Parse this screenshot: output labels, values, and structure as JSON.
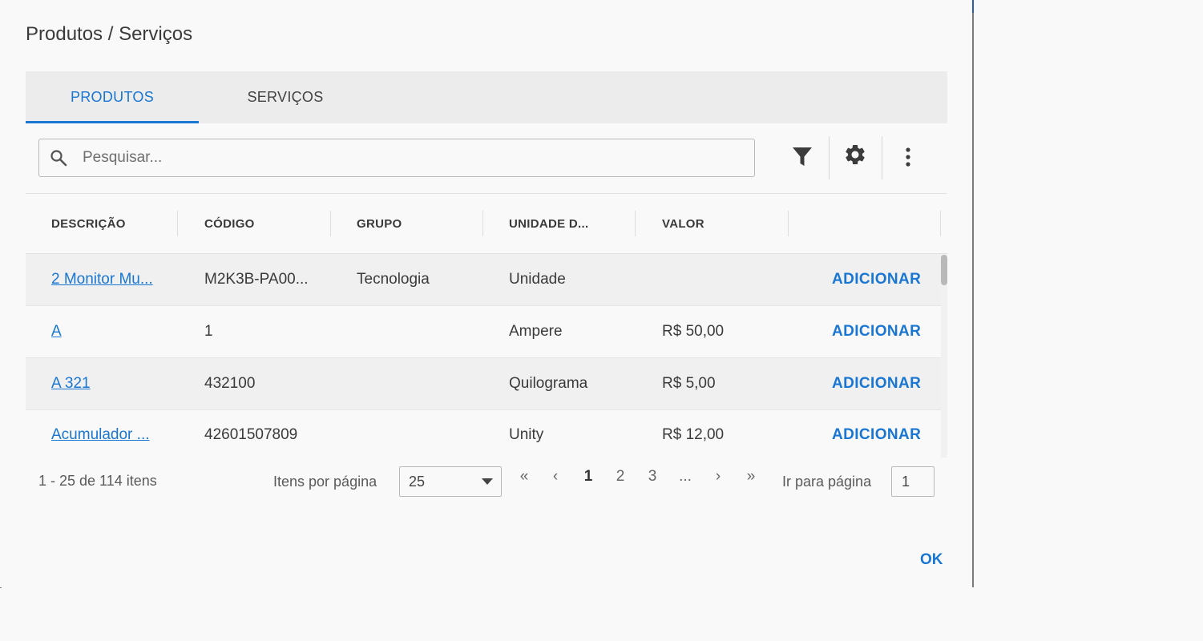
{
  "dialog": {
    "title": "Produtos / Serviços",
    "ok_label": "OK"
  },
  "tabs": [
    {
      "label": "PRODUTOS",
      "active": true
    },
    {
      "label": "SERVIÇOS",
      "active": false
    }
  ],
  "search": {
    "placeholder": "Pesquisar...",
    "value": ""
  },
  "toolbar": {
    "icons": [
      "filter-icon",
      "gear-icon",
      "more-vert-icon"
    ]
  },
  "table": {
    "headers": [
      "DESCRIÇÃO",
      "CÓDIGO",
      "GRUPO",
      "UNIDADE D...",
      "VALOR",
      ""
    ],
    "rows": [
      {
        "descricao": "2 Monitor Mu...",
        "codigo": "M2K3B-PA00...",
        "grupo": "Tecnologia",
        "unidade": "Unidade",
        "valor": "",
        "action": "ADICIONAR"
      },
      {
        "descricao": "A",
        "codigo": "1",
        "grupo": "",
        "unidade": "Ampere",
        "valor": "R$ 50,00",
        "action": "ADICIONAR"
      },
      {
        "descricao": "A 321",
        "codigo": "432100",
        "grupo": "",
        "unidade": "Quilograma",
        "valor": "R$ 5,00",
        "action": "ADICIONAR"
      },
      {
        "descricao": "Acumulador ...",
        "codigo": "42601507809",
        "grupo": "",
        "unidade": "Unity",
        "valor": "R$ 12,00",
        "action": "ADICIONAR"
      }
    ]
  },
  "pager": {
    "info": "1 - 25 de 114 itens",
    "per_page_label": "Itens por página",
    "per_page_value": "25",
    "first": "«",
    "prev": "‹",
    "pages": [
      "1",
      "2",
      "3",
      "..."
    ],
    "current_page": "1",
    "next": "›",
    "last": "»",
    "goto_label": "Ir para página",
    "goto_value": "1"
  },
  "colors": {
    "accent": "#1976d2",
    "tabbar_bg": "#ececec"
  }
}
